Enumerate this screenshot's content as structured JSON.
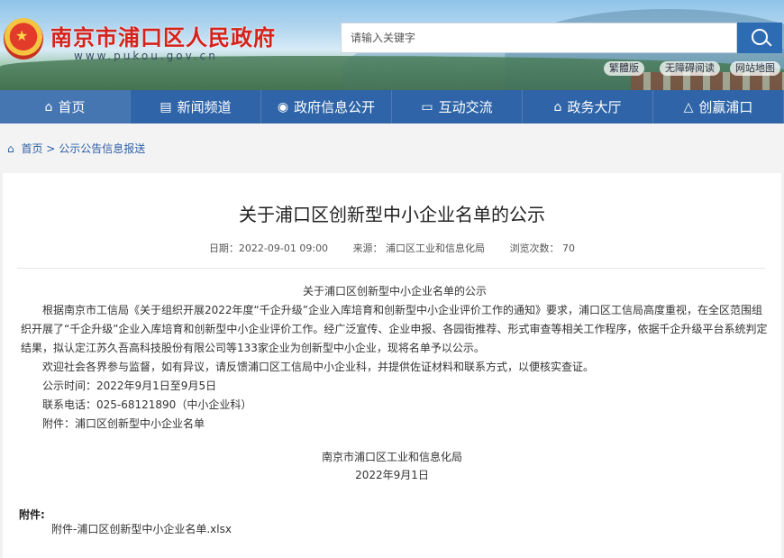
{
  "header": {
    "site_title": "南京市浦口区人民政府",
    "site_url": "www.pukou.gov.cn",
    "search_placeholder": "请输入关键字",
    "links": [
      "繁體版",
      "无障碍阅读",
      "网站地图"
    ]
  },
  "nav": {
    "items": [
      "首页",
      "新闻频道",
      "政府信息公开",
      "互动交流",
      "政务大厅",
      "创赢浦口"
    ]
  },
  "breadcrumb": {
    "home": "首页",
    "separator": ">",
    "current": "公示公告信息报送"
  },
  "article": {
    "title": "关于浦口区创新型中小企业名单的公示",
    "date": "日期：2022-09-01 09:00",
    "source": "来源：  浦口区工业和信息化局",
    "views": "浏览次数：   70",
    "subtitle": "关于浦口区创新型中小企业名单的公示",
    "paragraph1": "根据南京市工信局《关于组织开展2022年度“千企升级”企业入库培育和创新型中小企业评价工作的通知》要求，浦口区工信局高度重视，在全区范围组织开展了“千企升级”企业入库培育和创新型中小企业评价工作。经广泛宣传、企业申报、各园街推荐、形式审查等相关工作程序，依据千企升级平台系统判定结果，拟认定江苏久吾高科技股份有限公司等133家企业为创新型中小企业，现将名单予以公示。",
    "paragraph2": "欢迎社会各界参与监督，如有异议，请反馈浦口区工信局中小企业科，并提供佐证材料和联系方式，以便核实查证。",
    "period": "公示时间：2022年9月1日至9月5日",
    "phone": "联系电话：025-68121890（中小企业科）",
    "attachment_line": "附件：浦口区创新型中小企业名单",
    "issuer": "南京市浦口区工业和信息化局",
    "issue_date": "2022年9月1日",
    "attachments_label": "附件:",
    "attachment_file": "附件-浦口区创新型中小企业名单.xlsx"
  },
  "colors": {
    "nav_bg": "#2f65a8",
    "title_red": "#d5221b",
    "link_blue": "#2d5ea6"
  }
}
